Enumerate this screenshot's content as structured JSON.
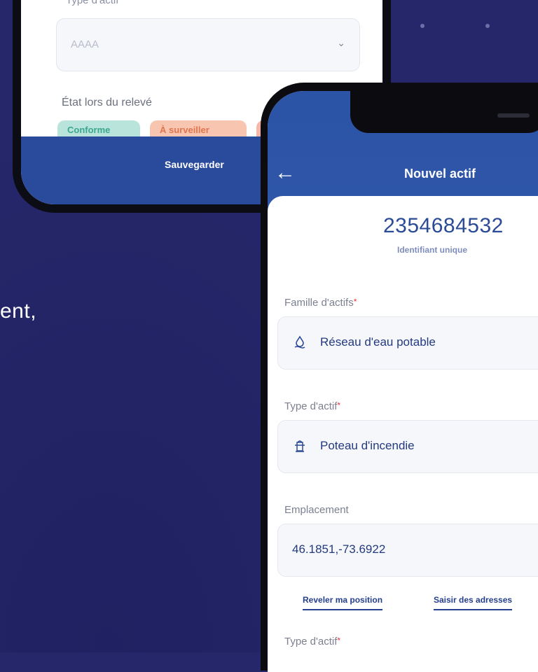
{
  "back_screen": {
    "type_label": "Type d'actif",
    "type_value": "AAAA",
    "etat_label": "État lors du relevé",
    "chips": [
      "Conforme",
      "À surveiller"
    ],
    "save_label": "Sauvegarder"
  },
  "side_text": "ent,",
  "front_screen": {
    "header": {
      "title": "Nouvel actif",
      "back_icon": "arrow-left-icon"
    },
    "identifier": {
      "value": "2354684532",
      "label": "Identifiant unique"
    },
    "fields": [
      {
        "label": "Famille d'actifs",
        "required": "*",
        "value": "Réseau d'eau potable",
        "icon": "water-drop-icon"
      },
      {
        "label": "Type d'actif",
        "required": "*",
        "value": "Poteau d'incendie",
        "icon": "fire-hydrant-icon"
      },
      {
        "label": "Emplacement",
        "value": "46.1851,-73.6922"
      }
    ],
    "links": {
      "position": "Reveler ma position",
      "addresses": "Saisir des adresses"
    },
    "bottom_label": {
      "label": "Type d'actif",
      "required": "*"
    }
  },
  "colors": {
    "background": "#25276a",
    "header": "#2b53a6",
    "accent": "#2b4b97",
    "required": "#e0343d"
  }
}
